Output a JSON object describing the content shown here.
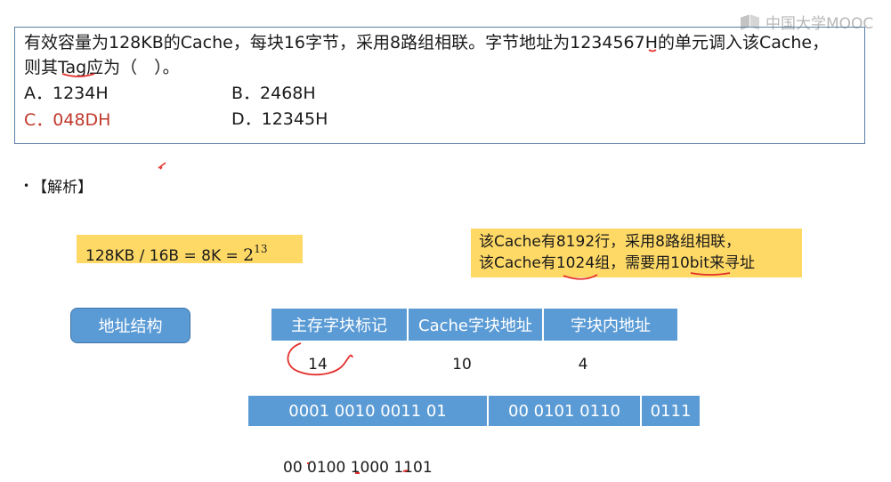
{
  "logo": {
    "text": "中国大学MOOC"
  },
  "question": {
    "line1": "有效容量为128KB的Cache，每块16字节，采用8路组相联。字节地址为1234567H的单元调入该Cache，",
    "line2": "则其Tag应为（　）。",
    "options": [
      {
        "label": "A．1234H"
      },
      {
        "label": "B．2468H"
      },
      {
        "label": "C．048DH",
        "color": "#c0392b"
      },
      {
        "label": "D．12345H"
      }
    ]
  },
  "analysis": {
    "heading": "【解析】"
  },
  "formula": {
    "text": "128KB / 16B = 8K  =",
    "base": "2",
    "exponent": "13"
  },
  "note": {
    "line1": "该Cache有8192行，采用8路组相联，",
    "line2": "该Cache有1024组，需要用10bit来寻址"
  },
  "address_structure": {
    "button_label": "地址结构",
    "fields": [
      {
        "name": "主存字块标记",
        "bits": "14"
      },
      {
        "name": "Cache字块地址",
        "bits": "10"
      },
      {
        "name": "字块内地址",
        "bits": "4"
      }
    ]
  },
  "binary": {
    "cells": [
      "0001  0010  0011 01",
      "00 0101 0110",
      "0111"
    ],
    "tag_result": "00 0100 1000 1101"
  },
  "colors": {
    "accent_blue": "#5b9bd5",
    "highlight_yellow": "#ffd966",
    "answer_red": "#c0392b",
    "pen_red": "#e3312d"
  }
}
